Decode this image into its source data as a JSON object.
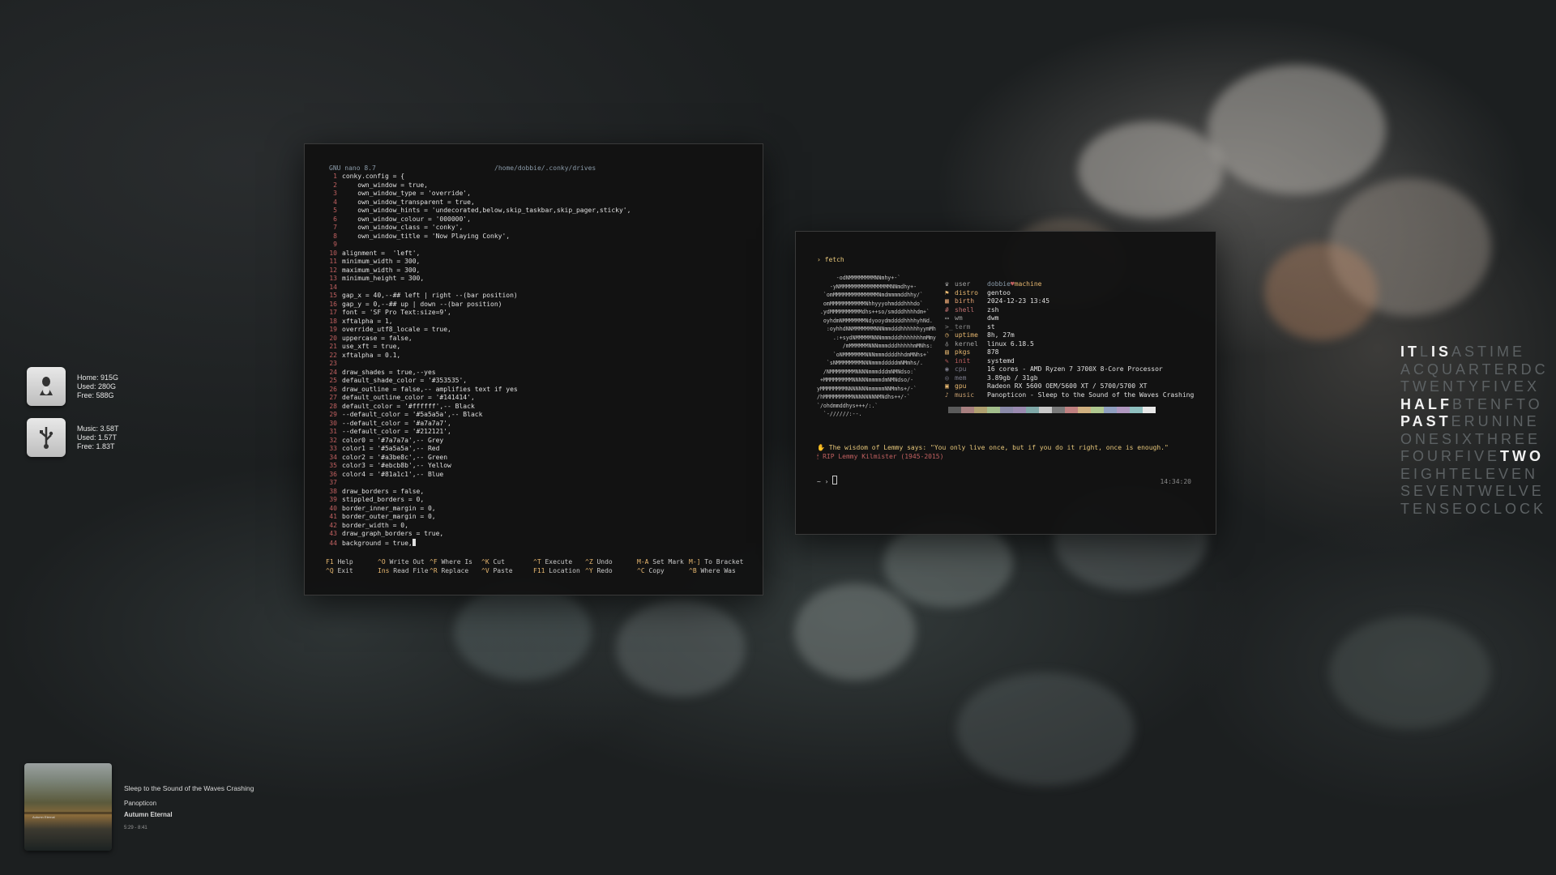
{
  "drives": [
    {
      "icon": "linux-drive-icon",
      "lines": [
        "Home: 915G",
        "Used: 280G",
        "Free: 588G"
      ]
    },
    {
      "icon": "usb-drive-icon",
      "lines": [
        "Music: 3.58T",
        "Used: 1.57T",
        "Free: 1.83T"
      ]
    }
  ],
  "nano": {
    "title": "GNU nano 8.7",
    "path": "/home/dobbie/.conky/drives",
    "lines": [
      {
        "n": "1",
        "t": "conky.config = {"
      },
      {
        "n": "2",
        "t": "    own_window = true,"
      },
      {
        "n": "3",
        "t": "    own_window_type = 'override',"
      },
      {
        "n": "4",
        "t": "    own_window_transparent = true,"
      },
      {
        "n": "5",
        "t": "    own_window_hints = 'undecorated,below,skip_taskbar,skip_pager,sticky',"
      },
      {
        "n": "6",
        "t": "    own_window_colour = '000000',"
      },
      {
        "n": "7",
        "t": "    own_window_class = 'conky',"
      },
      {
        "n": "8",
        "t": "    own_window_title = 'Now Playing Conky',"
      },
      {
        "n": "9",
        "t": ""
      },
      {
        "n": "10",
        "t": "alignment =  'left',"
      },
      {
        "n": "11",
        "t": "minimum_width = 300,"
      },
      {
        "n": "12",
        "t": "maximum_width = 300,"
      },
      {
        "n": "13",
        "t": "minimum_height = 300,"
      },
      {
        "n": "14",
        "t": ""
      },
      {
        "n": "15",
        "t": "gap_x = 40,--## left | right --(bar position)"
      },
      {
        "n": "16",
        "t": "gap_y = 0,--## up | down --(bar position)"
      },
      {
        "n": "17",
        "t": "font = 'SF Pro Text:size=9',"
      },
      {
        "n": "18",
        "t": "xftalpha = 1,"
      },
      {
        "n": "19",
        "t": "override_utf8_locale = true,"
      },
      {
        "n": "20",
        "t": "uppercase = false,"
      },
      {
        "n": "21",
        "t": "use_xft = true,"
      },
      {
        "n": "22",
        "t": "xftalpha = 0.1,"
      },
      {
        "n": "23",
        "t": ""
      },
      {
        "n": "24",
        "t": "draw_shades = true,--yes"
      },
      {
        "n": "25",
        "t": "default_shade_color = '#353535',"
      },
      {
        "n": "26",
        "t": "draw_outline = false,-- amplifies text if yes"
      },
      {
        "n": "27",
        "t": "default_outline_color = '#141414',"
      },
      {
        "n": "28",
        "t": "default_color = '#ffffff',-- Black"
      },
      {
        "n": "29",
        "t": "--default_color = '#5a5a5a',-- Black"
      },
      {
        "n": "30",
        "t": "--default_color = '#a7a7a7',"
      },
      {
        "n": "31",
        "t": "--default_color = '#212121',"
      },
      {
        "n": "32",
        "t": "color0 = '#7a7a7a',-- Grey"
      },
      {
        "n": "33",
        "t": "color1 = '#5a5a5a',-- Red"
      },
      {
        "n": "34",
        "t": "color2 = '#a3be8c',-- Green"
      },
      {
        "n": "35",
        "t": "color3 = '#ebcb8b',-- Yellow"
      },
      {
        "n": "36",
        "t": "color4 = '#81a1c1',-- Blue"
      },
      {
        "n": "37",
        "t": ""
      },
      {
        "n": "38",
        "t": "draw_borders = false,"
      },
      {
        "n": "39",
        "t": "stippled_borders = 0,"
      },
      {
        "n": "40",
        "t": "border_inner_margin = 0,"
      },
      {
        "n": "41",
        "t": "border_outer_margin = 0,"
      },
      {
        "n": "42",
        "t": "border_width = 0,"
      },
      {
        "n": "43",
        "t": "draw_graph_borders = true,"
      },
      {
        "n": "44",
        "t": "background = true,"
      }
    ],
    "help": [
      [
        {
          "k": "F1",
          "l": "Help"
        },
        {
          "k": "^O",
          "l": "Write Out"
        },
        {
          "k": "^F",
          "l": "Where Is"
        },
        {
          "k": "^K",
          "l": "Cut"
        },
        {
          "k": "^T",
          "l": "Execute"
        },
        {
          "k": "^Z",
          "l": "Undo"
        },
        {
          "k": "M-A",
          "l": "Set Mark"
        },
        {
          "k": "M-]",
          "l": "To Bracket"
        }
      ],
      [
        {
          "k": "^Q",
          "l": "Exit"
        },
        {
          "k": "Ins",
          "l": "Read File"
        },
        {
          "k": "^R",
          "l": "Replace"
        },
        {
          "k": "^V",
          "l": "Paste"
        },
        {
          "k": "F11",
          "l": "Location"
        },
        {
          "k": "^Y",
          "l": "Redo"
        },
        {
          "k": "^C",
          "l": "Copy"
        },
        {
          "k": "^B",
          "l": "Where Was"
        }
      ]
    ]
  },
  "fetch": {
    "prompt": "› fetch",
    "ascii": "       -odNMMMMMMMMNNmhy+-`\n     -yNMMMMMMMMMMMMMMMMNNmdhy+-\n   `omMMMMMMMMMMMMMMNmdmmmmddhhy/`\n   omMMMMMMMMMMMNhhyyyohmdddhhhdo`\n  .ydMMMMMMMMMMdhs++so/smdddhhhhdm+`\n   oyhdmNMMMMMMMNdyooydmddddhhhhyhNd.\n    :oyhhdNNMMMMMMMNNNmmdddhhhhhhyymMh\n      .:+sydNMMMMMNNNmmmdddhhhhhhhmMmy\n         /mMMMMMMNNNmmmdddhhhhhmMNhs:\n      `oNMMMMMMMNNNmmmddddhhdmMNhs+`\n    `sNMMMMMMMMNNNmmmdddddmNMmhs/.\n   /NMMMMMMMMNNNNmmmdddmNMNdso:`\n  +MMMMMMMMMNNNNNmmmmdmNMNdso/-\n yMMMMMMMMNNNNNNNmmmmmNNMmhs+/-`\n /hMMMMMMMMMNNNNNNNNMNdhs++/-`\n `/ohdmmddhys+++/:.`\n   `-//////:--.",
    "info": [
      {
        "icon": "♛",
        "key": "user",
        "val": "dobbie",
        "extra": "machine"
      },
      {
        "icon": "⚑",
        "key": "distro",
        "val": "gentoo"
      },
      {
        "icon": "▦",
        "key": "birth",
        "val": "2024-12-23 13:45"
      },
      {
        "icon": "#",
        "key": "shell",
        "val": "zsh"
      },
      {
        "icon": "▭",
        "key": "wm",
        "val": "dwm"
      },
      {
        "icon": ">_",
        "key": "term",
        "val": "st"
      },
      {
        "icon": "◷",
        "key": "uptime",
        "val": "8h, 27m"
      },
      {
        "icon": "♁",
        "key": "kernel",
        "val": "linux 6.18.5"
      },
      {
        "icon": "▤",
        "key": "pkgs",
        "val": "878"
      },
      {
        "icon": "✎",
        "key": "init",
        "val": "systemd"
      },
      {
        "icon": "◉",
        "key": "cpu",
        "val": "16 cores - AMD Ryzen 7 3700X 8-Core Processor"
      },
      {
        "icon": "◎",
        "key": "mem",
        "val": "3.89gb / 31gb"
      },
      {
        "icon": "▣",
        "key": "gpu",
        "val": "Radeon RX 5600 OEM/5600 XT / 5700/5700 XT"
      },
      {
        "icon": "♪",
        "key": "music",
        "val": "Panopticon - Sleep to the Sound of the Waves Crashing"
      }
    ],
    "key_colors": [
      "#a0a0a0",
      "#e8b870",
      "#e0a070",
      "#c07070",
      "#a0a0a0",
      "#808080",
      "#e8b870",
      "#a0a0a0",
      "#e8b870",
      "#c06060",
      "#7a7a8a",
      "#7a7a8a",
      "#e8b870",
      "#c8a070"
    ],
    "palette": [
      "#5a5a5a",
      "#a88080",
      "#b0a070",
      "#a3be8c",
      "#8a8aa8",
      "#9a8ab0",
      "#80a8a8",
      "#c8c8c8",
      "#7a7a7a",
      "#c08080",
      "#d0b080",
      "#b0c890",
      "#90a0c0",
      "#b098c0",
      "#90c0c0",
      "#e8e8e8"
    ],
    "quote1": "The wisdom of Lemmy says: \"You only live once, but if you do it right, once is enough.\"",
    "quote2": "RIP Lemmy Kilmister (1945-2015)",
    "term_prompt": "~ › ",
    "time": "14:34:20"
  },
  "word_clock": [
    [
      {
        "t": "IT",
        "lit": true
      },
      {
        "t": "L",
        "lit": false
      },
      {
        "t": "IS",
        "lit": true
      },
      {
        "t": "ASTIME",
        "lit": false
      }
    ],
    [
      {
        "t": "ACQUARTERDC",
        "lit": false
      }
    ],
    [
      {
        "t": "TWENTYFIVEX",
        "lit": false
      }
    ],
    [
      {
        "t": "HALF",
        "lit": true
      },
      {
        "t": "BTENFTO",
        "lit": false
      }
    ],
    [
      {
        "t": "PAST",
        "lit": true
      },
      {
        "t": "ERUNINE",
        "lit": false
      }
    ],
    [
      {
        "t": "ONESIXTHREE",
        "lit": false
      }
    ],
    [
      {
        "t": "FOURFIVE",
        "lit": false
      },
      {
        "t": "TWO",
        "lit": true
      }
    ],
    [
      {
        "t": "EIGHTELEVEN",
        "lit": false
      }
    ],
    [
      {
        "t": "SEVENTWELVE",
        "lit": false
      }
    ],
    [
      {
        "t": "TENSEOCLOCK",
        "lit": false
      }
    ]
  ],
  "now_playing": {
    "art_label": "Autumn Eternal",
    "track": "Sleep to the Sound of the Waves Crashing",
    "artist": "Panopticon",
    "album": "Autumn Eternal",
    "time": "5:29 - 8:41"
  }
}
